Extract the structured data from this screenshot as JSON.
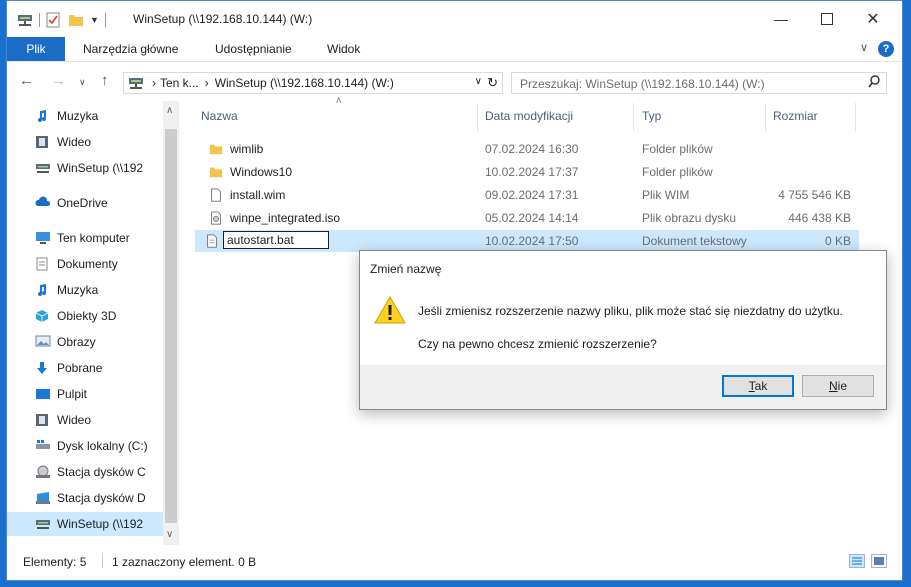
{
  "window": {
    "title": "WinSetup (\\\\192.168.10.144) (W:)"
  },
  "ribbon": {
    "tabs": [
      "Plik",
      "Narzędzia główne",
      "Udostępnianie",
      "Widok"
    ]
  },
  "address": {
    "crumbs": [
      "Ten k...",
      "WinSetup (\\\\192.168.10.144) (W:)"
    ],
    "search_placeholder": "Przeszukaj: WinSetup (\\\\192.168.10.144) (W:)"
  },
  "nav": {
    "items": [
      {
        "label": "Muzyka",
        "icon": "music-icon"
      },
      {
        "label": "Wideo",
        "icon": "video-icon"
      },
      {
        "label": "WinSetup (\\\\192",
        "icon": "network-drive-icon"
      },
      {
        "label": "OneDrive",
        "icon": "cloud-icon"
      },
      {
        "label": "Ten komputer",
        "icon": "computer-icon"
      },
      {
        "label": "Dokumenty",
        "icon": "documents-icon"
      },
      {
        "label": "Muzyka",
        "icon": "music-icon"
      },
      {
        "label": "Obiekty 3D",
        "icon": "cube-icon"
      },
      {
        "label": "Obrazy",
        "icon": "pictures-icon"
      },
      {
        "label": "Pobrane",
        "icon": "download-icon"
      },
      {
        "label": "Pulpit",
        "icon": "desktop-icon"
      },
      {
        "label": "Wideo",
        "icon": "video-icon"
      },
      {
        "label": "Dysk lokalny (C:)",
        "icon": "local-disk-icon"
      },
      {
        "label": "Stacja dysków C",
        "icon": "disc-drive-icon"
      },
      {
        "label": "Stacja dysków D",
        "icon": "disc-drive-icon"
      },
      {
        "label": "WinSetup (\\\\192",
        "icon": "network-drive-icon"
      }
    ]
  },
  "list": {
    "columns": [
      "Nazwa",
      "Data modyfikacji",
      "Typ",
      "Rozmiar"
    ],
    "rows": [
      {
        "name": "wimlib",
        "date": "07.02.2024 16:30",
        "type": "Folder plików",
        "size": "",
        "icon": "folder-icon"
      },
      {
        "name": "Windows10",
        "date": "10.02.2024 17:37",
        "type": "Folder plików",
        "size": "",
        "icon": "folder-icon"
      },
      {
        "name": "install.wim",
        "date": "09.02.2024 17:31",
        "type": "Plik WIM",
        "size": "4 755 546 KB",
        "icon": "file-icon"
      },
      {
        "name": "winpe_integrated.iso",
        "date": "05.02.2024 14:14",
        "type": "Plik obrazu dysku",
        "size": "446 438 KB",
        "icon": "disc-image-icon"
      },
      {
        "name": "autostart.bat",
        "date": "10.02.2024 17:50",
        "type": "Dokument tekstowy",
        "size": "0 KB",
        "icon": "text-file-icon"
      }
    ]
  },
  "status": {
    "count": "Elementy: 5",
    "selection": "1 zaznaczony element. 0 B"
  },
  "dialog": {
    "title": "Zmień nazwę",
    "message": "Jeśli zmienisz rozszerzenie nazwy pliku, plik może stać się niezdatny do użytku.",
    "question": "Czy na pewno chcesz zmienić rozszerzenie?",
    "yes_underlined": "T",
    "yes_rest": "ak",
    "no_underlined": "N",
    "no_rest": "ie"
  },
  "colors": {
    "accent": "#1a6cc6",
    "selection": "#cce8ff",
    "folder": "#f3c44d"
  }
}
